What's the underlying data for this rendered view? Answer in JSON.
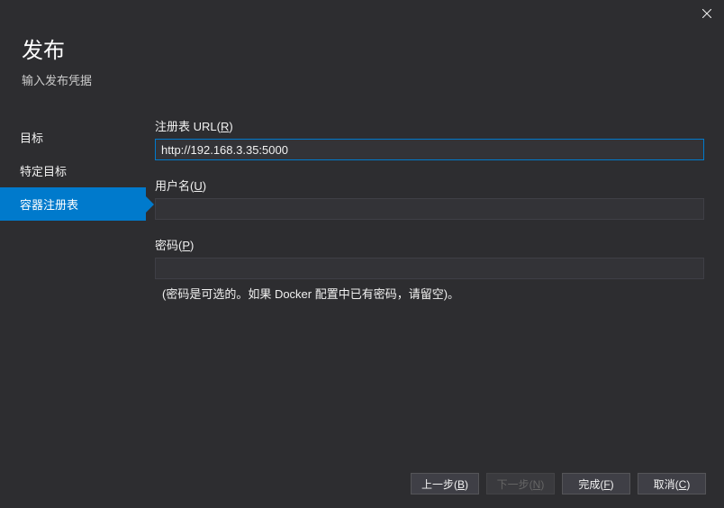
{
  "header": {
    "title": "发布",
    "subtitle": "输入发布凭据"
  },
  "sidebar": {
    "items": [
      {
        "label": "目标"
      },
      {
        "label": "特定目标"
      },
      {
        "label": "容器注册表"
      }
    ]
  },
  "form": {
    "registry_url": {
      "label_prefix": "注册表 URL(",
      "access_key": "R",
      "label_suffix": ")",
      "value": "http://192.168.3.35:5000"
    },
    "username": {
      "label_prefix": "用户名(",
      "access_key": "U",
      "label_suffix": ")",
      "value": ""
    },
    "password": {
      "label_prefix": "密码(",
      "access_key": "P",
      "label_suffix": ")",
      "value": "",
      "help": "(密码是可选的。如果 Docker 配置中已有密码，请留空)。"
    }
  },
  "footer": {
    "back": {
      "prefix": "上一步(",
      "key": "B",
      "suffix": ")"
    },
    "next": {
      "prefix": "下一步(",
      "key": "N",
      "suffix": ")"
    },
    "finish": {
      "prefix": "完成(",
      "key": "F",
      "suffix": ")"
    },
    "cancel": {
      "prefix": "取消(",
      "key": "C",
      "suffix": ")"
    }
  }
}
